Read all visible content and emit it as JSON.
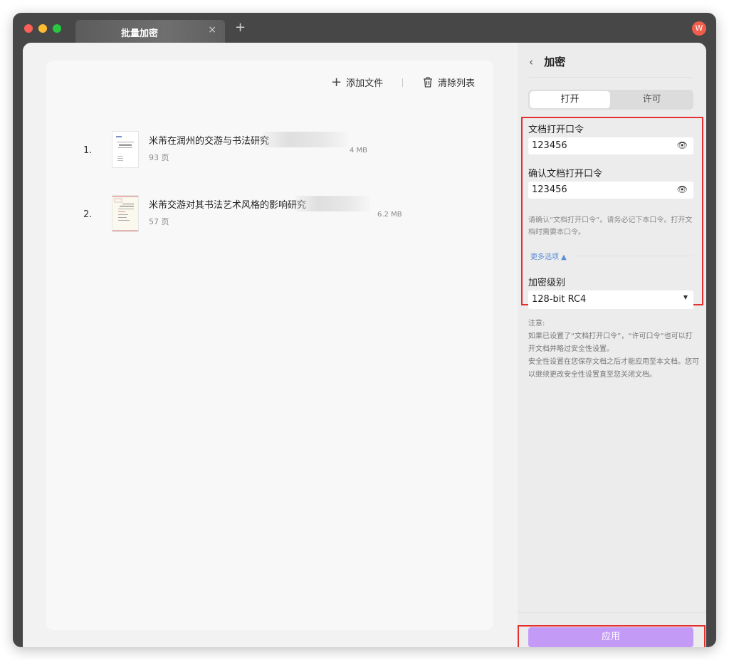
{
  "window": {
    "tab_title": "批量加密",
    "tab_close": "×",
    "tab_add": "+",
    "avatar_letter": "W",
    "avatar_color": "#f05d4c"
  },
  "toolbar": {
    "add_file_label": "添加文件",
    "clear_list_label": "清除列表"
  },
  "files": [
    {
      "index": "1.",
      "name": "米芾在润州的交游与书法研究",
      "pages": "93 页",
      "size": "4 MB"
    },
    {
      "index": "2.",
      "name": "米芾交游对其书法艺术风格的影响研究",
      "pages": "57 页",
      "size": "6.2 MB"
    }
  ],
  "panel": {
    "back": "‹",
    "title": "加密",
    "tabs": {
      "open": "打开",
      "permission": "许可"
    },
    "open_password_label": "文档打开口令",
    "open_password_value": "123456",
    "confirm_password_label": "确认文档打开口令",
    "confirm_password_value": "123456",
    "hint": "请确认“文档打开口令”。请务必记下本口令。打开文档时需要本口令。",
    "more_options": "更多选项 ▲",
    "encryption_level_label": "加密级别",
    "encryption_level_value": "128-bit RC4",
    "notes": [
      "注意:",
      "如果已设置了“文档打开口令”，“许可口令”也可以打开文档并略过安全性设置。",
      "安全性设置在您保存文档之后才能应用至本文档。您可以继续更改安全性设置直至您关闭文档。"
    ],
    "apply": "应用"
  },
  "colors": {
    "accent": "#c39bf7",
    "highlight": "#e53030",
    "link": "#5b8fd8"
  }
}
